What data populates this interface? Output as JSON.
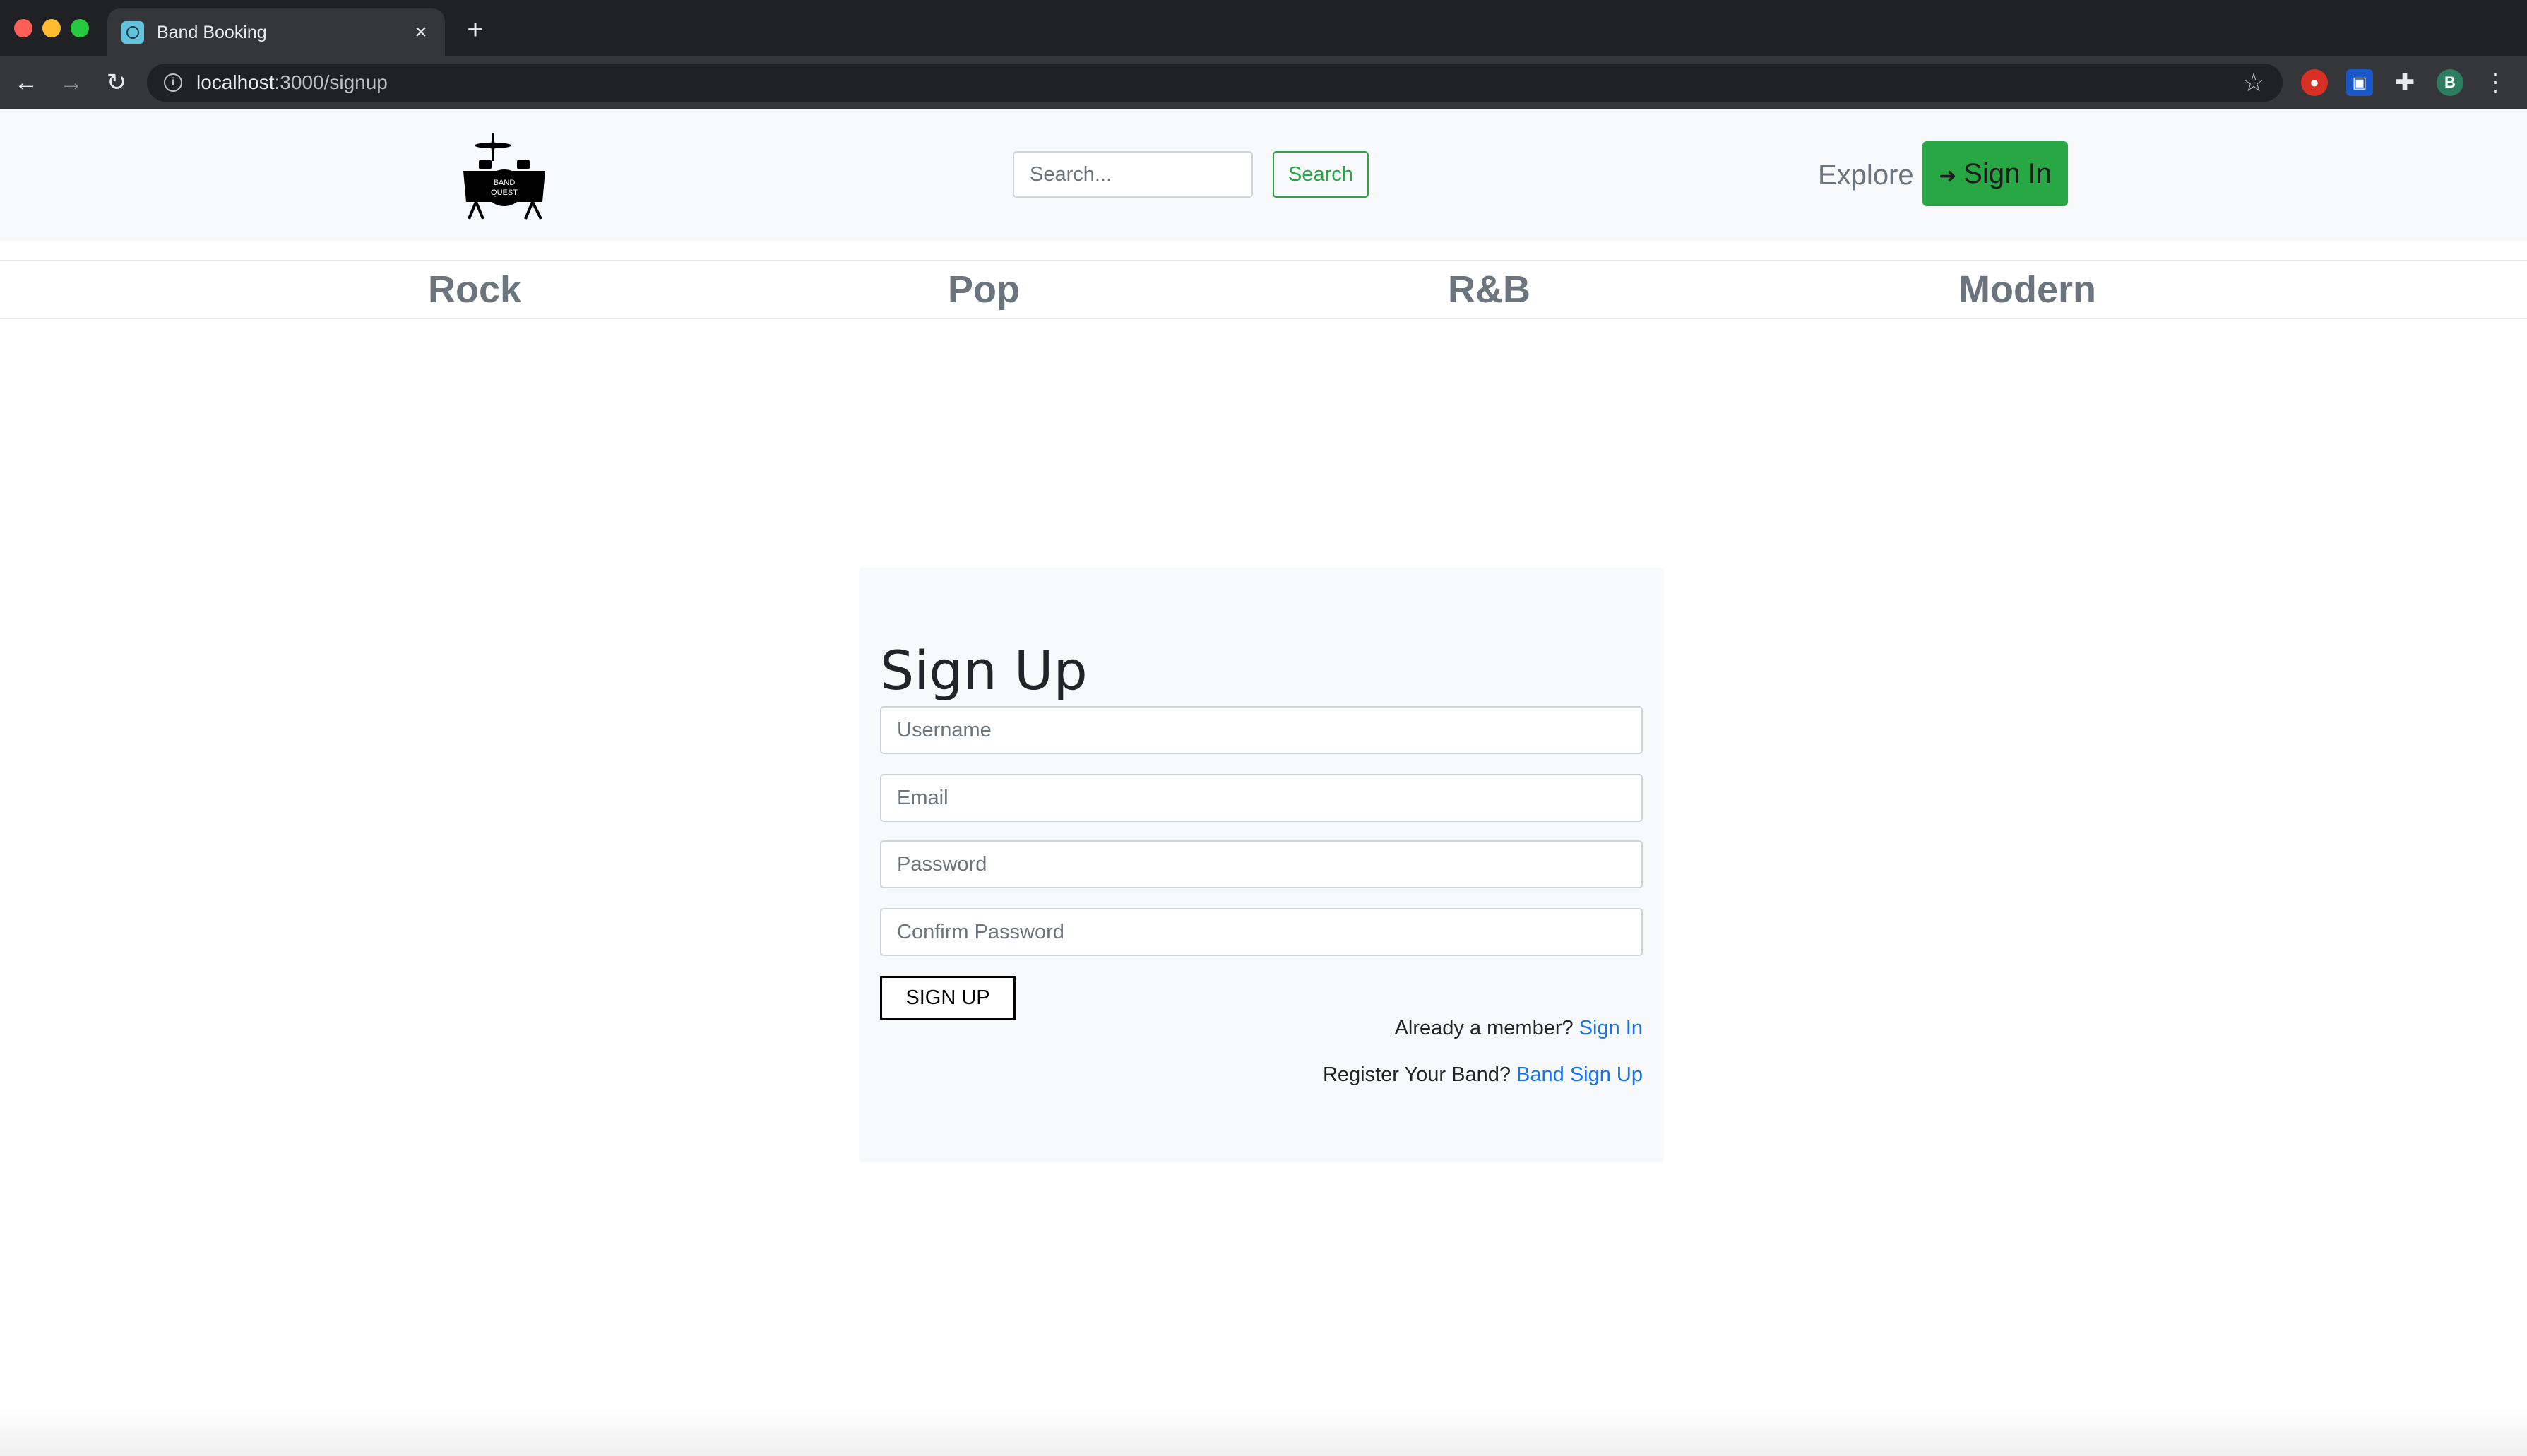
{
  "browser": {
    "tab_title": "Band Booking",
    "url_host": "localhost",
    "url_path": ":3000/signup",
    "avatar_letter": "B"
  },
  "navbar": {
    "logo_text_line1": "BAND",
    "logo_text_line2": "QUEST",
    "search_placeholder": "Search...",
    "search_button": "Search",
    "explore_link": "Explore",
    "signin_button": "Sign In"
  },
  "genres": [
    "Rock",
    "Pop",
    "R&B",
    "Modern"
  ],
  "signup": {
    "title": "Sign Up",
    "username_placeholder": "Username",
    "email_placeholder": "Email",
    "password_placeholder": "Password",
    "confirm_placeholder": "Confirm Password",
    "submit_label": "SIGN UP",
    "member_prompt": "Already a member? ",
    "member_link": "Sign In",
    "band_prompt": "Register Your Band? ",
    "band_link": "Band Sign Up"
  },
  "colors": {
    "success": "#28a745",
    "link": "#1a73e8",
    "muted": "#6c757d",
    "light_bg": "#f8f9fa"
  }
}
